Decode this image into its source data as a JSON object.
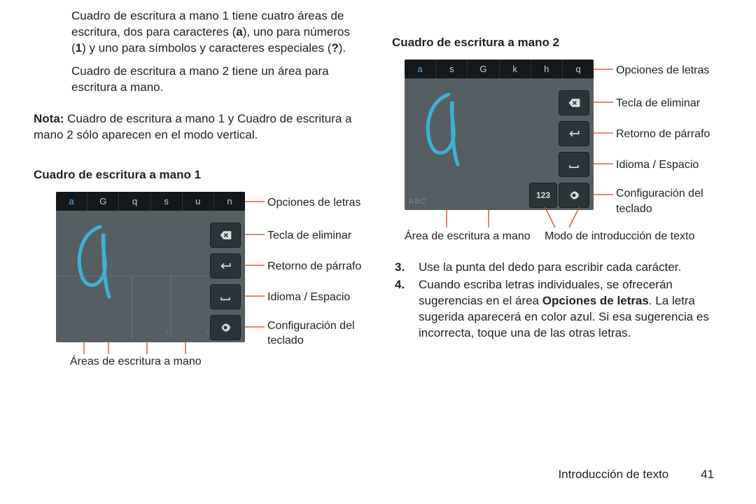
{
  "left": {
    "p1_a": "Cuadro de escritura a mano 1 tiene cuatro áreas de escritura, dos para caracteres (",
    "p1_bold1": "a",
    "p1_b": "), uno para números (",
    "p1_bold2": "1",
    "p1_c": ") y uno para símbolos y caracteres especiales (",
    "p1_bold3": "?",
    "p1_d": ").",
    "p2": "Cuadro de escritura a mano 2 tiene un área para escritura a mano.",
    "note_label": "Nota:",
    "note_body": " Cuadro de escritura a mano 1 y Cuadro de escritura a mano 2 sólo aparecen en el modo vertical.",
    "heading1": "Cuadro de escritura a mano 1",
    "letters1": [
      "a",
      "G",
      "q",
      "s",
      "u",
      "n"
    ],
    "areas_label": "Áreas de escritura a mano"
  },
  "right": {
    "heading2": "Cuadro de escritura a mano 2",
    "letters2": [
      "a",
      "s",
      "G",
      "k",
      "h",
      "q"
    ],
    "abc": "ABC",
    "mode_num": "123",
    "area_label": "Área de escritura a mano",
    "mode_label": "Modo de introducción de texto",
    "step3_num": "3.",
    "step3": "Use la punta del dedo para escribir cada carácter.",
    "step4_num": "4.",
    "step4_a": "Cuando escriba letras individuales, se ofrecerán sugerencias en el área ",
    "step4_bold": "Opciones de letras",
    "step4_b": ". La letra sugerida aparecerá en color azul. Si esa sugerencia es incorrecta, toque una de las otras letras."
  },
  "callouts": {
    "letters": "Opciones de letras",
    "delete": "Tecla de eliminar",
    "return": "Retorno de párrafo",
    "lang": "Idioma / Espacio",
    "settings": "Configuración del teclado"
  },
  "footer": {
    "section": "Introducción de texto",
    "page": "41"
  }
}
